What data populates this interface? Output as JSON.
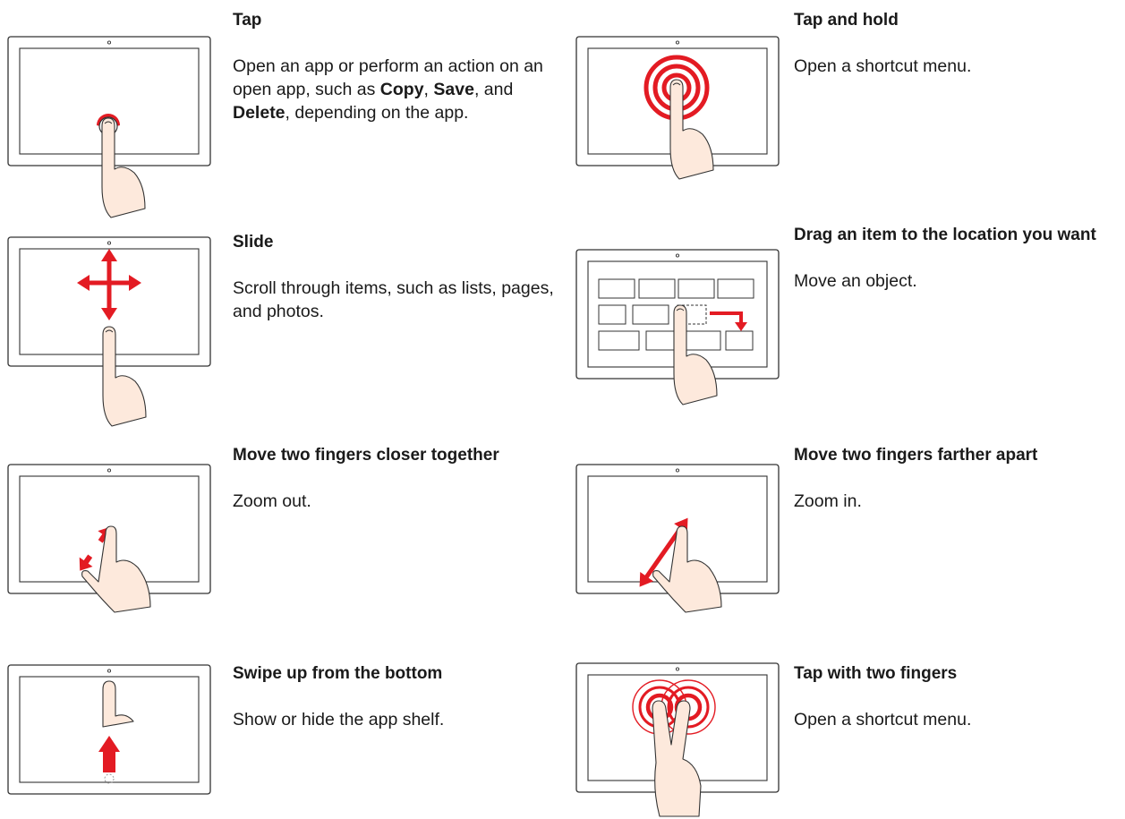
{
  "accent_color": "#e31b23",
  "gestures": [
    {
      "title": "Tap",
      "description": "Open an app or perform an action on an open app, such as Copy, Save, and Delete, depending on the app.",
      "illustration": "tap-gesture-icon"
    },
    {
      "title": "Tap and hold",
      "description": "Open a shortcut menu.",
      "illustration": "tap-and-hold-gesture-icon"
    },
    {
      "title": "Slide",
      "description": "Scroll through items, such as lists, pages, and photos.",
      "illustration": "slide-gesture-icon"
    },
    {
      "title": "Drag an item to the location you want",
      "description": "Move an object.",
      "illustration": "drag-gesture-icon"
    },
    {
      "title": "Move two fingers closer together",
      "description": "Zoom out.",
      "illustration": "pinch-in-gesture-icon"
    },
    {
      "title": "Move two fingers farther apart",
      "description": "Zoom in.",
      "illustration": "pinch-out-gesture-icon"
    },
    {
      "title": "Swipe up from the bottom",
      "description": "Show or hide the app shelf.",
      "illustration": "swipe-up-gesture-icon"
    },
    {
      "title": "Tap with two fingers",
      "description": "Open a shortcut menu.",
      "illustration": "two-finger-tap-gesture-icon"
    }
  ],
  "tap_desc_parts": {
    "before": "Open an app or perform an action on an open app, such as ",
    "copy": "Copy",
    "sep1": ", ",
    "save": "Save",
    "sep2": ", and ",
    "delete": "Delete",
    "after": ", depending on the app."
  }
}
